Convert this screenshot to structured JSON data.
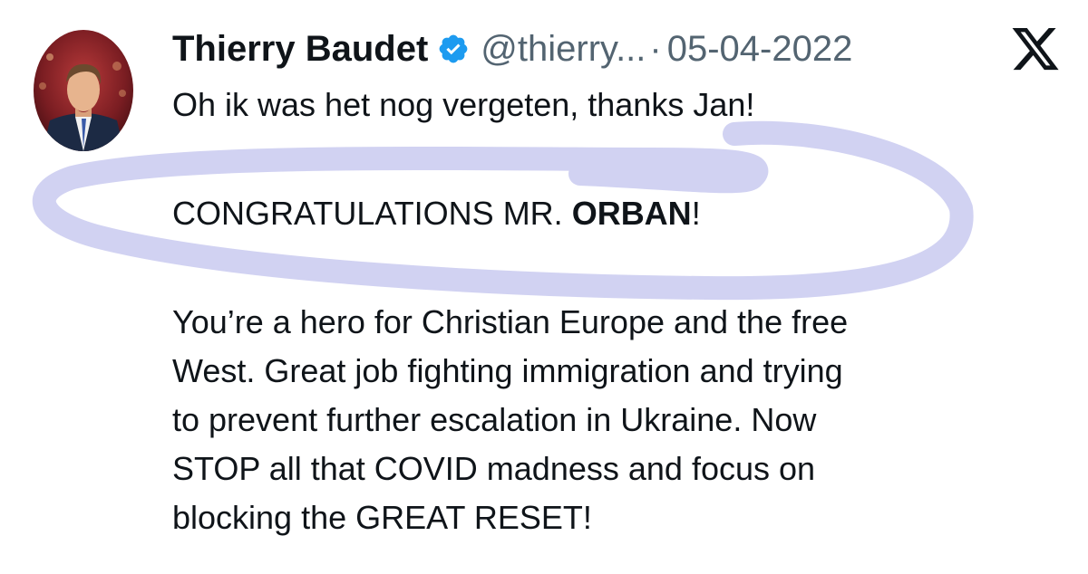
{
  "tweet": {
    "author_name": "Thierry Baudet",
    "handle": "@thierry...",
    "separator": "·",
    "date": "05-04-2022",
    "line1": "Oh ik was het nog vergeten, thanks Jan!",
    "line2_prefix": "CONGRATULATIONS MR. ",
    "line2_bold": "ORBAN",
    "line2_suffix": "!",
    "paragraph_lines": [
      "You’re a hero for Christian Europe and the free",
      "West. Great job fighting immigration and trying",
      "to prevent further escalation in Ukraine. Now",
      "STOP all that COVID madness and focus on",
      "blocking the GREAT RESET!"
    ]
  },
  "icons": {
    "verified": "verified-badge-icon",
    "platform": "x-logo-icon"
  },
  "colors": {
    "text": "#0f1419",
    "secondary": "#536471",
    "verified": "#1d9bf0",
    "highlight_scribble": "#c9caf0"
  }
}
